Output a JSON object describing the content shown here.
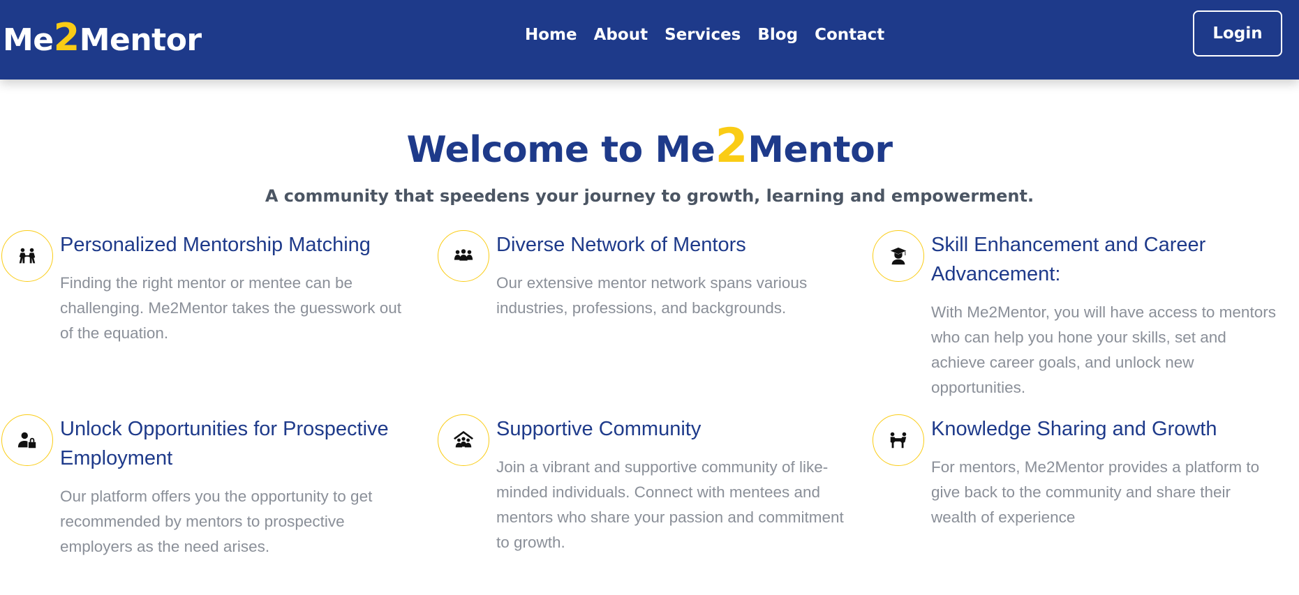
{
  "header": {
    "brand": {
      "prefix": "Me",
      "highlight": "2",
      "suffix": "Mentor"
    },
    "nav": [
      "Home",
      "About",
      "Services",
      "Blog",
      "Contact"
    ],
    "login_label": "Login"
  },
  "hero": {
    "title_prefix": "Welcome to Me",
    "title_highlight": "2",
    "title_suffix": "Mentor",
    "subtitle": "A community that speedens your journey to growth, learning and empowerment."
  },
  "features": [
    {
      "icon": "mentorship-matching-icon",
      "title": "Personalized Mentorship Matching",
      "text": "Finding the right mentor or mentee can be challenging. Me2Mentor takes the guesswork out of the equation."
    },
    {
      "icon": "network-group-icon",
      "title": "Diverse Network of Mentors",
      "text": "Our extensive mentor network spans various industries, professions, and backgrounds."
    },
    {
      "icon": "graduate-icon",
      "title": "Skill Enhancement and Career Advancement:",
      "text": "With Me2Mentor, you will have access to mentors who can help you hone your skills, set and achieve career goals, and unlock new opportunities."
    },
    {
      "icon": "user-lock-icon",
      "title": "Unlock Opportunities for Prospective Employment",
      "text": "Our platform offers you the opportunity to get recommended by mentors to prospective employers as the need arises."
    },
    {
      "icon": "community-roof-icon",
      "title": "Supportive Community",
      "text": "Join a vibrant and supportive community of like-minded individuals. Connect with mentees and mentors who share your passion and commitment to growth."
    },
    {
      "icon": "knowledge-sharing-icon",
      "title": "Knowledge Sharing and Growth",
      "text": "For mentors, Me2Mentor provides a platform to give back to the community and share their wealth of experience"
    }
  ],
  "colors": {
    "primary": "#1e3a8a",
    "accent": "#facc15",
    "body_text": "#8a8f98",
    "subtitle_text": "#4b5563"
  }
}
